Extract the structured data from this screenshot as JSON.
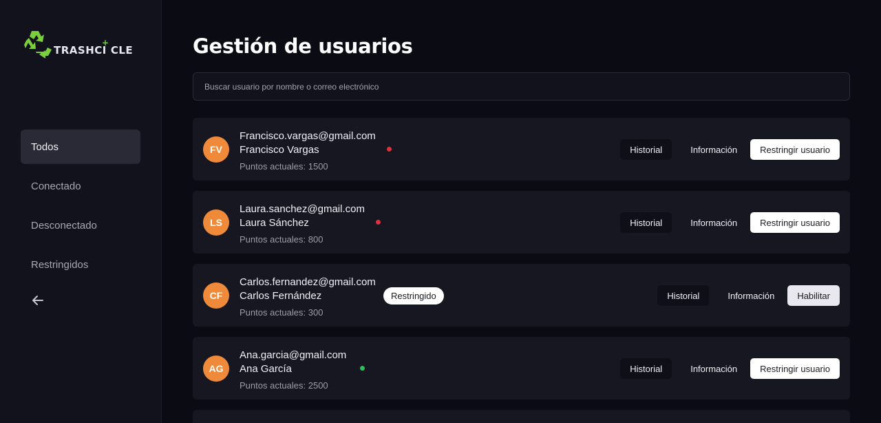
{
  "app": {
    "logo_text": "TRASHC",
    "logo_text_end": "CLE",
    "logo_plus": "+",
    "brand_color": "#7ad03a"
  },
  "sidebar": {
    "items": [
      {
        "label": "Todos",
        "active": true
      },
      {
        "label": "Conectado",
        "active": false
      },
      {
        "label": "Desconectado",
        "active": false
      },
      {
        "label": "Restringidos",
        "active": false
      }
    ],
    "back_icon": "arrow-left-icon"
  },
  "page": {
    "title": "Gestión de usuarios",
    "search_placeholder": "Buscar usuario por nombre o correo electrónico"
  },
  "colors": {
    "offline": "#e0303a",
    "online": "#2fbf5a",
    "avatar": "#ee8a3a"
  },
  "users": [
    {
      "initials": "FV",
      "email": "Francisco.vargas@gmail.com",
      "name": "Francisco Vargas",
      "points": "Puntos actuales: 1500",
      "status": "offline",
      "badge": "",
      "btn_historial": "Historial",
      "btn_info": "Información",
      "btn_primary": "Restringir usuario"
    },
    {
      "initials": "LS",
      "email": "Laura.sanchez@gmail.com",
      "name": "Laura Sánchez",
      "points": "Puntos actuales: 800",
      "status": "offline",
      "badge": "",
      "btn_historial": "Historial",
      "btn_info": "Información",
      "btn_primary": "Restringir usuario"
    },
    {
      "initials": "CF",
      "email": "Carlos.fernandez@gmail.com",
      "name": "Carlos Fernández",
      "points": "Puntos actuales: 300",
      "status": "restricted",
      "badge": "Restringido",
      "btn_historial": "Historial",
      "btn_info": "Información",
      "btn_primary": "Habilitar"
    },
    {
      "initials": "AG",
      "email": "Ana.garcia@gmail.com",
      "name": "Ana García",
      "points": "Puntos actuales: 2500",
      "status": "online",
      "badge": "",
      "btn_historial": "Historial",
      "btn_info": "Información",
      "btn_primary": "Restringir usuario"
    }
  ]
}
